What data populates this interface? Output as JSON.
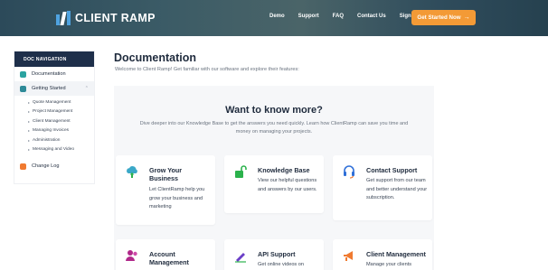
{
  "header": {
    "logo_text": "CLIENT RAMP",
    "nav": [
      "Demo",
      "Support",
      "FAQ",
      "Contact Us",
      "Sign In"
    ],
    "cta_label": "Get Started Now",
    "cta_arrow": "→",
    "colors": {
      "cta": "#f39a36",
      "header_bg": "#3b5b66"
    }
  },
  "sidebar": {
    "heading": "DOC NAVIGATION",
    "items": [
      {
        "label": "Documentation",
        "icon": "document-icon"
      },
      {
        "label": "Getting Started",
        "icon": "rocket-icon",
        "chevron": "⌃"
      }
    ],
    "sub_items": [
      "Quote Management",
      "Project Management",
      "Client Management",
      "Managing Invoices",
      "Administration",
      "Messaging and Video"
    ],
    "bottom_item": {
      "label": "Change Log",
      "icon": "changelog-icon"
    },
    "colors": {
      "heading_bg": "#1e2f4a"
    }
  },
  "main": {
    "title": "Documentation",
    "intro": "Welcome to Client Ramp! Get familiar with our software and explore their features:",
    "panel": {
      "title": "Want to know more?",
      "description": "Dive deeper into our Knowledge Base to get the answers you need quickly. Learn how ClientRamp can save you time and money on managing your projects."
    },
    "cards": [
      {
        "title": "Grow Your Business",
        "text": "Let ClientRamp help you grow your business and marketing",
        "icon": "cloud-growth-icon",
        "color": "#3aa8c8"
      },
      {
        "title": "Knowledge Base",
        "text": "View our helpful questions and answers by our users.",
        "icon": "unlock-icon",
        "color": "#2bb24c"
      },
      {
        "title": "Contact Support",
        "text": "Get support from our team and better understand your subscription.",
        "icon": "headset-icon",
        "color": "#2f6fd8"
      },
      {
        "title": "Account Management",
        "text": "",
        "icon": "users-icon",
        "color": "#b0288a"
      },
      {
        "title": "API Support",
        "text": "Get online videos on",
        "icon": "pencil-icon",
        "color": "#6b3fc8"
      },
      {
        "title": "Client Management",
        "text": "Manage your clients",
        "icon": "megaphone-icon",
        "color": "#f07a30"
      }
    ]
  }
}
